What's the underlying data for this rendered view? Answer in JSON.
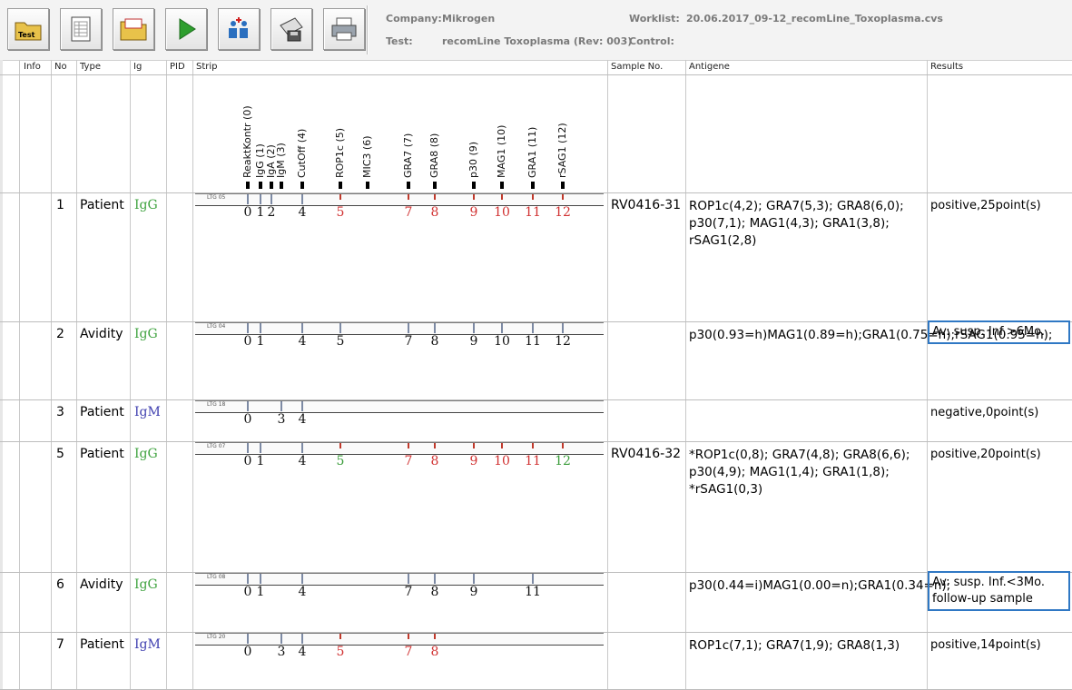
{
  "toolbar": {
    "buttons": [
      {
        "name": "test-folder-icon",
        "label": "Test"
      },
      {
        "name": "worksheet-icon",
        "label": ""
      },
      {
        "name": "open-folder-icon",
        "label": ""
      },
      {
        "name": "run-icon",
        "label": ""
      },
      {
        "name": "compare-icon",
        "label": ""
      },
      {
        "name": "scan-save-icon",
        "label": ""
      },
      {
        "name": "print-icon",
        "label": ""
      }
    ],
    "company_label": "Company:",
    "company_value": "Mikrogen",
    "test_label": "Test:",
    "test_value": "recomLine Toxoplasma (Rev: 003)",
    "worklist_label": "Worklist:",
    "worklist_value": "20.06.2017_09-12_recomLine_Toxoplasma.cvs",
    "control_label": "Control:"
  },
  "columns": {
    "info": "Info",
    "no": "No",
    "type": "Type",
    "ig": "Ig",
    "pid": "PID",
    "strip": "Strip",
    "sample": "Sample No.",
    "antigene": "Antigene",
    "results": "Results"
  },
  "band_labels": [
    "ReaktKontr (0)",
    "IgG (1)",
    "IgA (2)",
    "IgM (3)",
    "CutOff (4)",
    "ROP1c (5)",
    "MIC3 (6)",
    "GRA7 (7)",
    "GRA8 (8)",
    "p30 (9)",
    "MAG1 (10)",
    "GRA1 (11)",
    "rSAG1 (12)"
  ],
  "rows": [
    {
      "no": "1",
      "type": "Patient",
      "ig": "IgG",
      "strip_label": "LTG 05",
      "sample": "RV0416-31",
      "antigene": "ROP1c(4,2); GRA7(5,3); GRA8(6,0); p30(7,1); MAG1(4,3); GRA1(3,8); rSAG1(2,8)",
      "result": "positive,25point(s)",
      "nums": [
        {
          "t": "0",
          "c": "black"
        },
        {
          "t": "1",
          "c": "black"
        },
        {
          "t": "2",
          "c": "black"
        },
        {
          "t": "4",
          "c": "black"
        },
        {
          "t": "5",
          "c": "red"
        },
        {
          "t": "7",
          "c": "red"
        },
        {
          "t": "8",
          "c": "red"
        },
        {
          "t": "9",
          "c": "red"
        },
        {
          "t": "10",
          "c": "red"
        },
        {
          "t": "11",
          "c": "red"
        },
        {
          "t": "12",
          "c": "red"
        }
      ]
    },
    {
      "no": "2",
      "type": "Avidity",
      "ig": "IgG",
      "strip_label": "LTG 04",
      "sample": "",
      "antigene": "p30(0.93=h)MAG1(0.89=h);GRA1(0.75=h);rSAG1(0.95=h);",
      "result": "Av: susp. Inf.>6Mo.",
      "nums": [
        {
          "t": "0",
          "c": "black"
        },
        {
          "t": "1",
          "c": "black"
        },
        {
          "t": "4",
          "c": "black"
        },
        {
          "t": "5",
          "c": "black"
        },
        {
          "t": "7",
          "c": "black"
        },
        {
          "t": "8",
          "c": "black"
        },
        {
          "t": "9",
          "c": "black"
        },
        {
          "t": "10",
          "c": "black"
        },
        {
          "t": "11",
          "c": "black"
        },
        {
          "t": "12",
          "c": "black"
        }
      ]
    },
    {
      "no": "3",
      "type": "Patient",
      "ig": "IgM",
      "strip_label": "LTG 18",
      "sample": "",
      "antigene": "",
      "result": "negative,0point(s)",
      "nums": [
        {
          "t": "0",
          "c": "black"
        },
        {
          "t": "3",
          "c": "black"
        },
        {
          "t": "4",
          "c": "black"
        }
      ]
    },
    {
      "no": "5",
      "type": "Patient",
      "ig": "IgG",
      "strip_label": "LTG 07",
      "sample": "RV0416-32",
      "antigene": "*ROP1c(0,8); GRA7(4,8); GRA8(6,6); p30(4,9); MAG1(1,4); GRA1(1,8); *rSAG1(0,3)",
      "result": "positive,20point(s)",
      "nums": [
        {
          "t": "0",
          "c": "black"
        },
        {
          "t": "1",
          "c": "black"
        },
        {
          "t": "4",
          "c": "black"
        },
        {
          "t": "5",
          "c": "green"
        },
        {
          "t": "7",
          "c": "red"
        },
        {
          "t": "8",
          "c": "red"
        },
        {
          "t": "9",
          "c": "red"
        },
        {
          "t": "10",
          "c": "red"
        },
        {
          "t": "11",
          "c": "red"
        },
        {
          "t": "12",
          "c": "green"
        }
      ]
    },
    {
      "no": "6",
      "type": "Avidity",
      "ig": "IgG",
      "strip_label": "LTG 08",
      "sample": "",
      "antigene": "p30(0.44=i)MAG1(0.00=n);GRA1(0.34=n);",
      "result": "Av: susp. Inf.<3Mo. follow-up sample",
      "nums": [
        {
          "t": "0",
          "c": "black"
        },
        {
          "t": "1",
          "c": "black"
        },
        {
          "t": "4",
          "c": "black"
        },
        {
          "t": "7",
          "c": "black"
        },
        {
          "t": "8",
          "c": "black"
        },
        {
          "t": "9",
          "c": "black"
        },
        {
          "t": "11",
          "c": "black"
        }
      ]
    },
    {
      "no": "7",
      "type": "Patient",
      "ig": "IgM",
      "strip_label": "LTG 20",
      "sample": "",
      "antigene": "ROP1c(7,1); GRA7(1,9); GRA8(1,3)",
      "result": "positive,14point(s)",
      "nums": [
        {
          "t": "0",
          "c": "black"
        },
        {
          "t": "3",
          "c": "black"
        },
        {
          "t": "4",
          "c": "black"
        },
        {
          "t": "5",
          "c": "red"
        },
        {
          "t": "7",
          "c": "red"
        },
        {
          "t": "8",
          "c": "red"
        }
      ]
    }
  ],
  "colors": {
    "igG": "#3fa33f",
    "igM": "#4040b0",
    "positive": "#d13232",
    "borderline": "#3a9c3a",
    "highlight": "#2f78c4"
  }
}
